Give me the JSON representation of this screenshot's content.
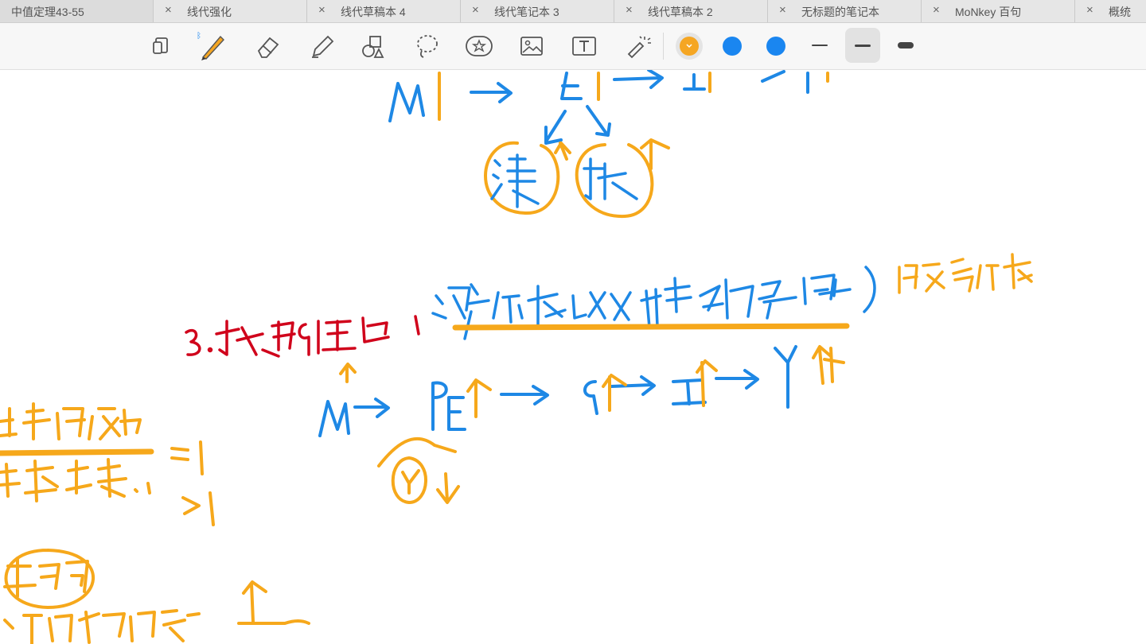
{
  "tabs": [
    {
      "label": "中值定理43-55"
    },
    {
      "label": "线代强化"
    },
    {
      "label": "线代草稿本 4"
    },
    {
      "label": "线代笔记本 3"
    },
    {
      "label": "线代草稿本 2"
    },
    {
      "label": "无标题的笔记本"
    },
    {
      "label": "MoNkey 百句"
    },
    {
      "label": "概统"
    }
  ],
  "tab_close_glyph": "×",
  "toolbar": {
    "tools": [
      "page-layout-icon",
      "pen-icon",
      "eraser-icon",
      "highlighter-icon",
      "shapes-icon",
      "lasso-icon",
      "sticker-icon",
      "image-icon",
      "text-icon",
      "laser-pointer-icon"
    ],
    "active_tool": "pen-icon",
    "colors": [
      "#f5a623",
      "#1a86f0",
      "#1a86f0"
    ],
    "selected_color": "#f5a623",
    "stroke_widths": [
      "thin",
      "medium",
      "thick"
    ],
    "selected_width": "medium"
  },
  "notes": {
    "section_heading": "3.",
    "ink_colors": {
      "blue": "#1e88e5",
      "orange": "#f6a81b",
      "red": "#d0021b"
    }
  }
}
